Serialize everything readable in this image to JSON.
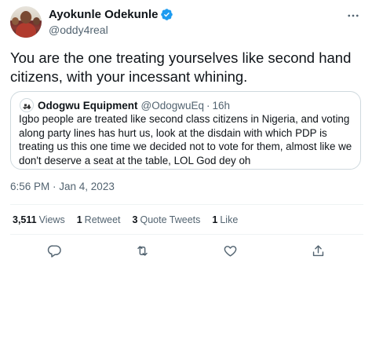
{
  "author": {
    "name": "Ayokunle Odekunle",
    "handle": "@oddy4real",
    "verified": true
  },
  "tweet": {
    "text": "You are the one treating yourselves like second hand citizens, with your incessant whining.",
    "timestamp": "6:56 PM · Jan 4, 2023"
  },
  "quoted": {
    "name": "Odogwu Equipment",
    "handle": "@OdogwuEq",
    "separator": "·",
    "time": "16h",
    "text": "Igbo people are treated like second class citizens in Nigeria,  and voting along party lines has hurt us, look at the disdain with which PDP is treating us this one time we decided not to vote for them, almost like we don't deserve a seat at the table, LOL God dey oh"
  },
  "stats": {
    "views_count": "3,511",
    "views_label": "Views",
    "retweets_count": "1",
    "retweets_label": "Retweet",
    "quotes_count": "3",
    "quotes_label": "Quote Tweets",
    "likes_count": "1",
    "likes_label": "Like"
  },
  "icons": {
    "verified": "verified-badge-icon",
    "more": "more-icon",
    "reply": "reply-icon",
    "retweet": "retweet-icon",
    "like": "like-icon",
    "share": "share-icon"
  },
  "colors": {
    "accent": "#1d9bf0",
    "text": "#0f1419",
    "secondary": "#536471",
    "border": "#cfd9de"
  }
}
